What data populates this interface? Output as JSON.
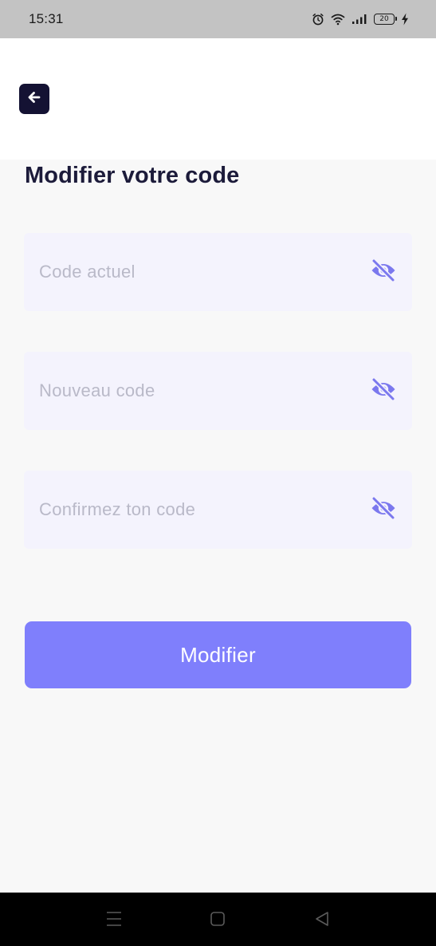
{
  "status_bar": {
    "time": "15:31",
    "battery_level": "20",
    "icons": [
      "alarm-icon",
      "wifi-icon",
      "signal-icon",
      "battery-icon",
      "charging-icon"
    ]
  },
  "header": {
    "back_icon": "arrow-left-icon"
  },
  "page": {
    "title": "Modifier votre code"
  },
  "form": {
    "fields": [
      {
        "placeholder": "Code actuel",
        "toggle_icon": "eye-off-icon"
      },
      {
        "placeholder": "Nouveau code",
        "toggle_icon": "eye-off-icon"
      },
      {
        "placeholder": "Confirmez ton code",
        "toggle_icon": "eye-off-icon"
      }
    ],
    "submit_label": "Modifier"
  },
  "nav_bar": {
    "icons": [
      "menu-icon",
      "home-icon",
      "back-triangle-icon"
    ]
  },
  "colors": {
    "primary": "#7f7ffc",
    "title_text": "#1c1b3a",
    "field_background": "#f4f3fd",
    "placeholder_text": "#b9b9c8",
    "icon_accent": "#7b78ee",
    "back_button": "#141233"
  }
}
